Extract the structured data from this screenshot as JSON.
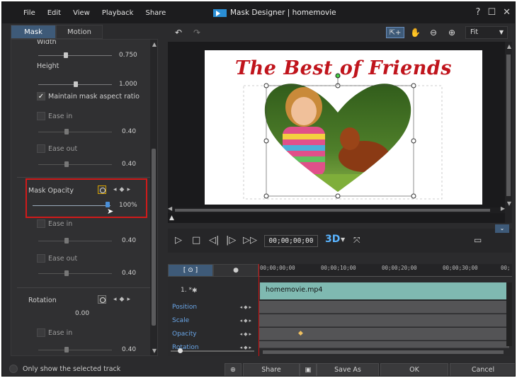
{
  "menu": [
    "File",
    "Edit",
    "View",
    "Playback",
    "Share"
  ],
  "window_title": "Mask Designer | homemovie",
  "window_controls": [
    "?",
    "☐",
    "✕"
  ],
  "tabs": [
    {
      "label": "Mask",
      "active": true
    },
    {
      "label": "Motion",
      "active": false
    }
  ],
  "left_panel": {
    "width_label": "Width",
    "width_value": "0.750",
    "height_label": "Height",
    "height_value": "1.000",
    "maintain_aspect": {
      "label": "Maintain mask aspect ratio",
      "checked": true
    },
    "ease_in_1": {
      "label": "Ease in",
      "value": "0.40"
    },
    "ease_out_1": {
      "label": "Ease out",
      "value": "0.40"
    },
    "mask_opacity": {
      "label": "Mask Opacity",
      "value": "100%"
    },
    "ease_in_2": {
      "label": "Ease in",
      "value": "0.40"
    },
    "ease_out_2": {
      "label": "Ease out",
      "value": "0.40"
    },
    "rotation": {
      "label": "Rotation",
      "value": "0.00"
    },
    "ease_in_3": {
      "label": "Ease in",
      "value": "0.40"
    }
  },
  "only_selected_track": "Only show the selected track",
  "viewer": {
    "fit_label": "Fit",
    "canvas_title": "The Best of Friends"
  },
  "transport": {
    "timecode": "00;00;00;00",
    "mode_3d": "3D"
  },
  "timeline": {
    "ruler": [
      "00;00;00;00",
      "00;00;10;00",
      "00;00;20;00",
      "00;00;30;00",
      "00;"
    ],
    "track_label": "1. *",
    "clip_name": "homemovie.mp4",
    "tracks": [
      "Position",
      "Scale",
      "Opacity",
      "Rotation"
    ]
  },
  "buttons": {
    "share": "Share",
    "save_as": "Save As",
    "ok": "OK",
    "cancel": "Cancel"
  },
  "colors": {
    "accent": "#3e5a78",
    "highlight_box": "#d11a1a",
    "clip": "#7fb9b1",
    "title_red": "#c0141c"
  }
}
